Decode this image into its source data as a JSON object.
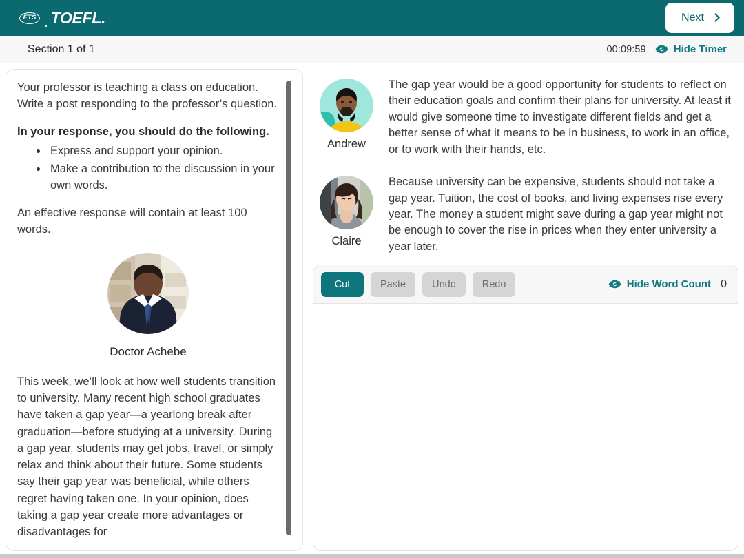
{
  "header": {
    "brand_ets": "ETS",
    "brand_toefl": "TOEFL.",
    "next_label": "Next",
    "next_icon": "chevron-right-icon"
  },
  "section_bar": {
    "section_label": "Section 1 of 1",
    "timer_value": "00:09:59",
    "hide_timer_label": "Hide Timer",
    "hide_timer_icon": "eye-slash-icon"
  },
  "prompt": {
    "intro": "Your professor is teaching a class on education. Write a post responding to the professor’s question.",
    "directions_heading": "In your response, you should do the following.",
    "directions": [
      "Express and support your opinion.",
      "Make a contribution to the discussion in your own words."
    ],
    "word_requirement": "An effective response will contain at least 100 words.",
    "professor_name": "Doctor Achebe",
    "professor_avatar": "professor-photo",
    "professor_text": "This week, we’ll look at how well students transition to university. Many recent high school graduates have taken a gap year—a yearlong break after graduation—before studying at a university. During a gap year, students may get jobs, travel, or simply relax and think about their future. Some students say their gap year was beneficial, while others regret having taken one. In your opinion, does taking a gap year create more advantages or disadvantages for"
  },
  "discussion": {
    "posts": [
      {
        "name": "Andrew",
        "avatar": "andrew-photo",
        "text": "The gap year would be a good opportunity for students to reflect on their education goals and confirm their plans for university. At least it would give someone time to investigate different fields and get a better sense of what it means to be in business, to work in an office, or to work with their hands, etc."
      },
      {
        "name": "Claire",
        "avatar": "claire-photo",
        "text": "Because university can be expensive, students should not take a gap year. Tuition, the cost of books, and living expenses rise every year. The money a student might save during a gap year might not be enough to cover the rise in prices when they enter university a year later."
      }
    ]
  },
  "editor": {
    "buttons": [
      {
        "label": "Cut",
        "state": "active"
      },
      {
        "label": "Paste",
        "state": "disabled"
      },
      {
        "label": "Undo",
        "state": "disabled"
      },
      {
        "label": "Redo",
        "state": "disabled"
      }
    ],
    "hide_word_count_label": "Hide Word Count",
    "hide_word_count_icon": "eye-slash-icon",
    "word_count": "0",
    "response_value": "",
    "response_placeholder": ""
  },
  "colors": {
    "header_teal": "#0a6a70",
    "accent_teal": "#0d767c",
    "link_teal": "#0f7b80",
    "disabled_grey": "#d5d5d5"
  }
}
